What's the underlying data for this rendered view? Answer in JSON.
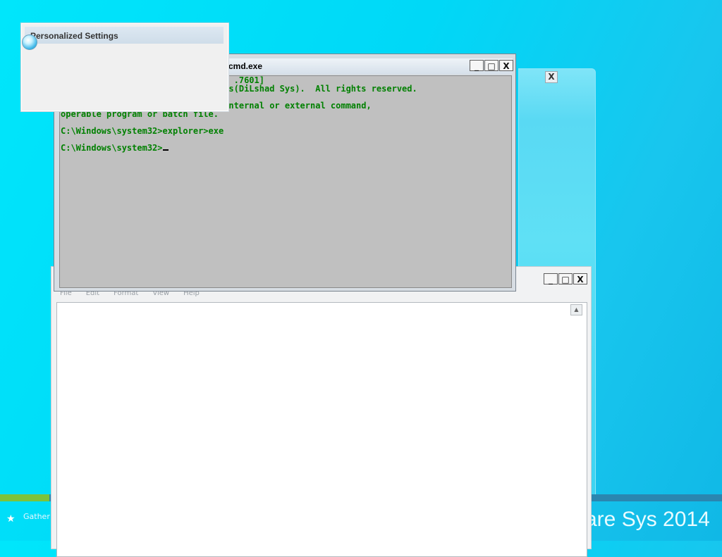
{
  "personalized_settings": {
    "title": "Personalized Settings",
    "icon": "busy-spinner-icon"
  },
  "cmd_window": {
    "title": "cmd.exe",
    "lines": [
      "                                  .7601]",
      "                                 s(DiLshad Sys).  All rights reserved.",
      "",
      "'regit' is not recognized as an internal or external command,",
      "operable program or batch file.",
      "",
      "C:\\Windows\\system32>explorer>exe",
      "",
      "C:\\Windows\\system32>"
    ],
    "text_color": "#008000",
    "background_color": "#C0C0C0"
  },
  "notepad_window": {
    "menu": [
      "File",
      "Edit",
      "Format",
      "View",
      "Help"
    ]
  },
  "window_controls": {
    "minimize": "_",
    "maximize": "□",
    "close": "X"
  },
  "glass_window": {
    "close": "X"
  },
  "status": {
    "gathering_text": "Gather",
    "star": "★",
    "progress": 0.068,
    "progress_color": "#7DC23A"
  },
  "desktop": {
    "brand_text": "are Sys 2014",
    "background_color": "#00E0FA"
  }
}
